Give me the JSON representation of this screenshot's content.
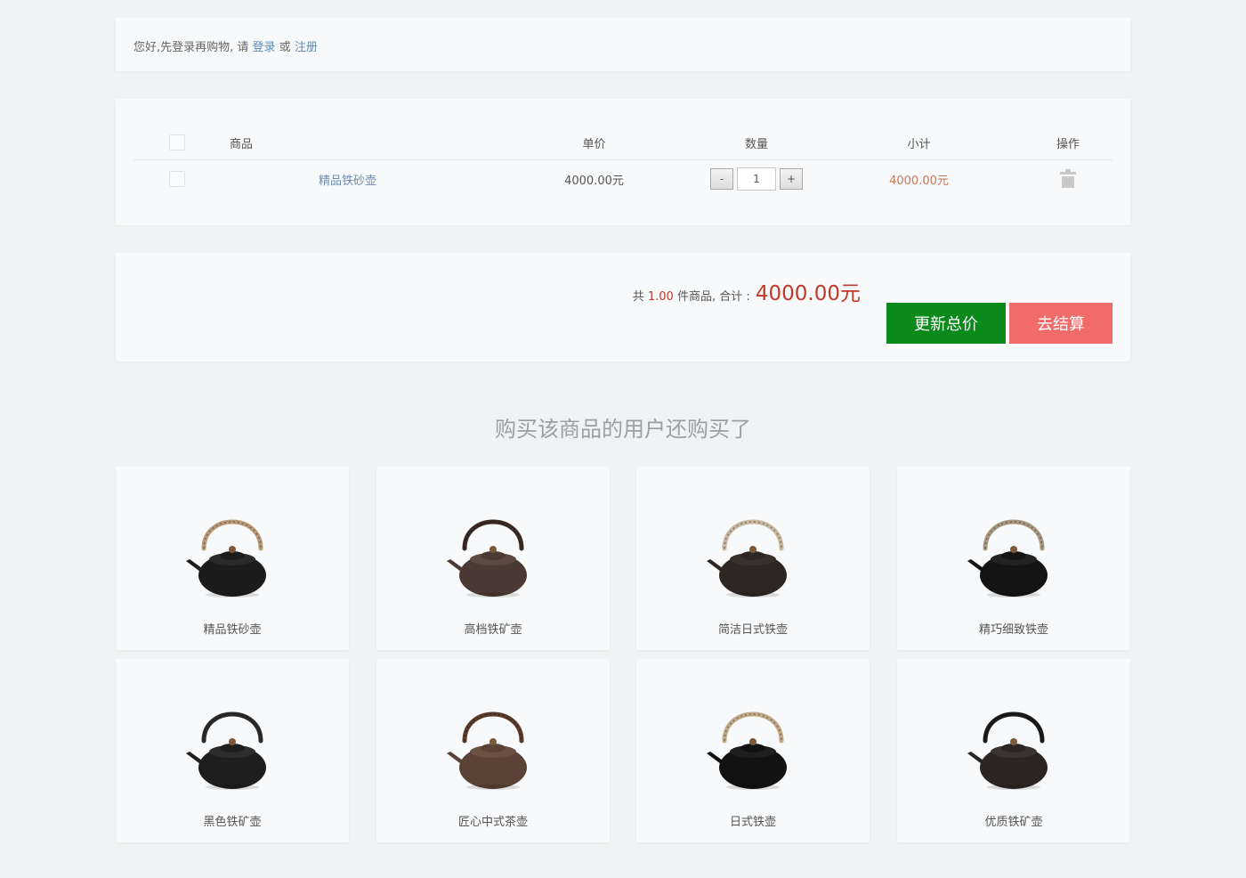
{
  "notice": {
    "text_before": "您好,先登录再购物, 请 ",
    "login": "登录",
    "or": " 或 ",
    "register": "注册"
  },
  "cart": {
    "headers": {
      "product": "商品",
      "price": "单价",
      "qty": "数量",
      "subtotal": "小计",
      "action": "操作"
    },
    "items": [
      {
        "name": "精品铁砂壶",
        "price": "4000.00元",
        "qty": "1",
        "subtotal": "4000.00元"
      }
    ],
    "qty_minus": "-",
    "qty_plus": "+"
  },
  "summary": {
    "prefix": "共 ",
    "count": "1.00",
    "middle": " 件商品,   合计 : ",
    "total": "4000.00元",
    "update_button": "更新总价",
    "checkout_button": "去结算"
  },
  "recommend": {
    "title": "购买该商品的用户还购买了",
    "items": [
      {
        "name": "精品铁砂壶",
        "icon": "teapot-image"
      },
      {
        "name": "高档铁矿壶",
        "icon": "teapot-image"
      },
      {
        "name": "简洁日式铁壶",
        "icon": "teapot-image"
      },
      {
        "name": "精巧细致铁壶",
        "icon": "teapot-image"
      },
      {
        "name": "黑色铁矿壶",
        "icon": "teapot-image"
      },
      {
        "name": "匠心中式茶壶",
        "icon": "teapot-image"
      },
      {
        "name": "日式铁壶",
        "icon": "teapot-image"
      },
      {
        "name": "优质铁矿壶",
        "icon": "teapot-image"
      }
    ]
  },
  "colors": {
    "accent_link": "#5b8bb8",
    "price_red": "#c0392b",
    "update_green": "#0a8a1a",
    "checkout_red": "#f26b6b"
  }
}
